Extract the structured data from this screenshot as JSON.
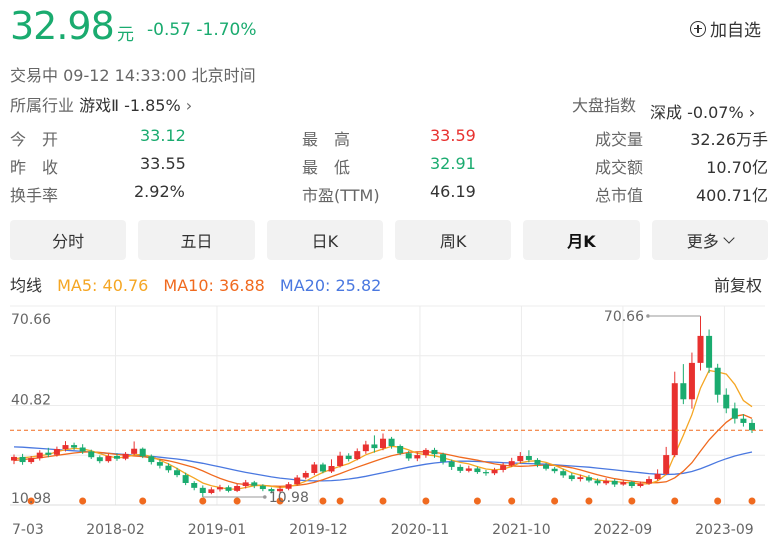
{
  "quote": {
    "price": "32.98",
    "unit": "元",
    "change": "-0.57 -1.70%",
    "add_label": "加自选",
    "status": "交易中  09-12 14:33:00  北京时间",
    "industry_label": "所属行业",
    "industry_value": "游戏Ⅱ -1.85%",
    "market_label": "大盘指数",
    "market_value": "深成 -0.07%",
    "colors": {
      "down": "#1aab6f",
      "up": "#e8312f",
      "neutral": "#333333"
    }
  },
  "stats": [
    {
      "label": "今　开",
      "value": "33.12",
      "color": "#1aab6f"
    },
    {
      "label": "最　高",
      "value": "33.59",
      "color": "#e8312f"
    },
    {
      "label": "成交量",
      "value": "32.26万手",
      "color": "#333333"
    },
    {
      "label": "昨　收",
      "value": "33.55",
      "color": "#333333"
    },
    {
      "label": "最　低",
      "value": "32.91",
      "color": "#1aab6f"
    },
    {
      "label": "成交额",
      "value": "10.70亿",
      "color": "#333333"
    },
    {
      "label": "换手率",
      "value": "2.92%",
      "color": "#333333"
    },
    {
      "label": "市盈(TTM)",
      "value": "46.19",
      "color": "#333333"
    },
    {
      "label": "总市值",
      "value": "400.71亿",
      "color": "#333333"
    }
  ],
  "tabs": [
    {
      "label": "分时",
      "active": false
    },
    {
      "label": "五日",
      "active": false
    },
    {
      "label": "日K",
      "active": false
    },
    {
      "label": "周K",
      "active": false
    },
    {
      "label": "月K",
      "active": true
    },
    {
      "label": "更多",
      "active": false
    }
  ],
  "ma": {
    "title": "均线",
    "ma5": "MA5: 40.76",
    "ma10": "MA10: 36.88",
    "ma20": "MA20: 25.82",
    "adjust": "前复权",
    "colors": {
      "ma5": "#f5a623",
      "ma10": "#f06a1f",
      "ma20": "#4a78e0"
    }
  },
  "chart_data": {
    "type": "candlestick",
    "y_ticks": [
      "70.66",
      "40.82",
      "10.98"
    ],
    "y_range": [
      10.98,
      70.66
    ],
    "x_ticks": [
      "7-03",
      "2018-02",
      "2019-01",
      "2019-12",
      "2020-11",
      "2021-10",
      "2022-09",
      "2023-09"
    ],
    "max_label": "70.66",
    "min_label": "10.98",
    "current_price": 32.98,
    "grid": true,
    "colors": {
      "up": "#e8312f",
      "down": "#1aab6f",
      "ma5": "#f5a623",
      "ma10": "#f06a1f",
      "ma20": "#4a78e0",
      "dots": "#f06a1f"
    },
    "candles": [
      [
        23,
        24.2,
        21.8,
        25
      ],
      [
        24.2,
        22.5,
        21.6,
        25.2
      ],
      [
        22.5,
        23.8,
        21.9,
        24.5
      ],
      [
        23.8,
        25.6,
        23,
        26.4
      ],
      [
        25.6,
        24.9,
        24.1,
        27.2
      ],
      [
        24.9,
        26.8,
        24.3,
        27.6
      ],
      [
        26.8,
        28.1,
        26,
        29.4
      ],
      [
        28.1,
        27.3,
        26.5,
        28.9
      ],
      [
        27.3,
        26,
        25.2,
        28.4
      ],
      [
        26,
        24.1,
        23.5,
        26.6
      ],
      [
        24.1,
        22.8,
        22.1,
        24.7
      ],
      [
        22.8,
        24.5,
        22.3,
        25.2
      ],
      [
        24.5,
        23.6,
        22.9,
        25.4
      ],
      [
        23.6,
        25.2,
        23.1,
        25.8
      ],
      [
        25.2,
        26.9,
        24.8,
        29.3
      ],
      [
        26.9,
        24.4,
        23.8,
        27.3
      ],
      [
        24.4,
        22.5,
        21.7,
        25
      ],
      [
        22.5,
        21.3,
        20.4,
        23.4
      ],
      [
        21.3,
        19.8,
        19,
        22.1
      ],
      [
        19.8,
        18.2,
        17.5,
        20.6
      ],
      [
        18.2,
        15.6,
        14.9,
        19
      ],
      [
        15.6,
        14,
        13.2,
        16.2
      ],
      [
        14,
        12.3,
        10.98,
        14.8
      ],
      [
        12.3,
        13.5,
        11.9,
        14.2
      ],
      [
        13.5,
        14.2,
        12.8,
        15
      ],
      [
        14.2,
        13,
        12.5,
        14.8
      ],
      [
        13,
        14.6,
        12.6,
        15.3
      ],
      [
        14.6,
        15.8,
        13.8,
        16.6
      ],
      [
        15.8,
        14.7,
        13.9,
        16.3
      ],
      [
        14.7,
        13.6,
        12.9,
        15.2
      ],
      [
        13.6,
        12.9,
        12.2,
        14.1
      ],
      [
        12.9,
        13.7,
        12.4,
        14.5
      ],
      [
        13.7,
        15.2,
        13.2,
        15.9
      ],
      [
        15.2,
        17.4,
        14.8,
        18.2
      ],
      [
        17.4,
        18.9,
        16.8,
        19.6
      ],
      [
        18.9,
        21.7,
        18.2,
        22.5
      ],
      [
        21.7,
        19.4,
        18.8,
        22.3
      ],
      [
        19.4,
        21.2,
        18.9,
        23.4
      ],
      [
        21.2,
        24.6,
        20.7,
        25.9
      ],
      [
        24.6,
        23.5,
        22.7,
        25.4
      ],
      [
        23.5,
        26.1,
        23.1,
        27
      ],
      [
        26.1,
        28.3,
        25.2,
        29.5
      ],
      [
        28.3,
        27.1,
        25.6,
        31.3
      ],
      [
        27.1,
        30.2,
        26.4,
        31.9
      ],
      [
        30.2,
        27.8,
        26.9,
        30.8
      ],
      [
        27.8,
        25.4,
        24.8,
        28.3
      ],
      [
        25.4,
        23.7,
        22.9,
        26.2
      ],
      [
        23.7,
        24.8,
        22.8,
        25.6
      ],
      [
        24.8,
        26.5,
        23.9,
        27.1
      ],
      [
        26.5,
        25.1,
        23.9,
        27.2
      ],
      [
        25.1,
        22.6,
        21.7,
        25.6
      ],
      [
        22.6,
        20.9,
        19.9,
        23.3
      ],
      [
        20.9,
        19.6,
        18.9,
        21.7
      ],
      [
        19.6,
        20.4,
        19.1,
        21.3
      ],
      [
        20.4,
        19.2,
        18.6,
        21
      ],
      [
        19.2,
        18.8,
        18,
        19.9
      ],
      [
        18.8,
        19.9,
        18.2,
        20.6
      ],
      [
        19.9,
        21.4,
        19.1,
        22.3
      ],
      [
        21.4,
        22.8,
        20.9,
        23.9
      ],
      [
        22.8,
        24.5,
        22.1,
        25.8
      ],
      [
        24.5,
        23.2,
        22.4,
        26.4
      ],
      [
        23.2,
        21.6,
        20.8,
        23.8
      ],
      [
        21.6,
        20.3,
        19.7,
        22.2
      ],
      [
        20.3,
        19.5,
        18.8,
        20.9
      ],
      [
        19.5,
        18.1,
        17.3,
        20.2
      ],
      [
        18.1,
        16.9,
        16.2,
        18.9
      ],
      [
        16.9,
        17.5,
        16.1,
        18.4
      ],
      [
        17.5,
        16.4,
        15.8,
        18.2
      ],
      [
        16.4,
        15.5,
        14.8,
        17.1
      ],
      [
        15.5,
        16.3,
        14.9,
        17.2
      ],
      [
        16.3,
        15.1,
        14.3,
        16.9
      ],
      [
        15.1,
        15.9,
        14.7,
        16.5
      ],
      [
        15.9,
        14.6,
        13.9,
        16.3
      ],
      [
        14.6,
        15.4,
        14.1,
        16.1
      ],
      [
        15.4,
        16.9,
        15,
        17.8
      ],
      [
        16.9,
        18.6,
        16.4,
        20.1
      ],
      [
        18.6,
        24.8,
        18.2,
        27.5
      ],
      [
        24.8,
        48.5,
        24.1,
        52.3
      ],
      [
        48.5,
        43.2,
        41.6,
        54.8
      ],
      [
        43.2,
        55.2,
        40.1,
        58.6
      ],
      [
        55.2,
        64.1,
        52.7,
        70.66
      ],
      [
        64.1,
        53.6,
        51.9,
        66.2
      ],
      [
        53.6,
        44.7,
        42.1,
        54.9
      ],
      [
        44.7,
        40.2,
        38.6,
        46.8
      ],
      [
        40.2,
        36.8,
        35.2,
        42.1
      ],
      [
        36.8,
        35.4,
        34.2,
        38.3
      ],
      [
        35.4,
        32.98,
        32.1,
        36.6
      ]
    ],
    "ma5": [
      23.6,
      23.9,
      24.2,
      24.6,
      25,
      25.9,
      26.6,
      27,
      26.8,
      26.2,
      25.3,
      24.4,
      23.9,
      24.1,
      24.9,
      25,
      24.3,
      23.1,
      21.9,
      20.4,
      18.7,
      17.2,
      15.6,
      14.7,
      14.1,
      13.6,
      13.6,
      14.1,
      14.7,
      14.8,
      14.5,
      14.1,
      14.3,
      15.1,
      16.2,
      17.7,
      19.1,
      20.1,
      21.1,
      22,
      23.4,
      24.9,
      25.9,
      26.8,
      27.7,
      27.4,
      26.5,
      25.4,
      24.9,
      24.6,
      23.9,
      23.1,
      22.4,
      21.9,
      21,
      20.2,
      19.9,
      20.2,
      21,
      22.3,
      22.8,
      22.9,
      22.4,
      21.4,
      20.2,
      19,
      18.2,
      17.3,
      16.6,
      16.3,
      16.1,
      15.8,
      15.6,
      15.3,
      15.3,
      16.3,
      18.4,
      25,
      31.3,
      38.1,
      46.9,
      52.7,
      52.2,
      51.5,
      48.1,
      42.8,
      40.76
    ],
    "ma10": [
      23,
      23.3,
      23.6,
      23.9,
      24.3,
      24.7,
      25.1,
      25.5,
      25.8,
      25.9,
      25.7,
      25.4,
      25,
      24.8,
      24.5,
      24.3,
      23.9,
      23.4,
      22.9,
      22.3,
      21.5,
      20.7,
      19.6,
      18.3,
      17.1,
      16.2,
      15.4,
      15.1,
      14.9,
      14.8,
      14.6,
      14.5,
      14.6,
      14.8,
      15.2,
      15.8,
      16.7,
      17.7,
      18.7,
      19.8,
      20.8,
      21.8,
      22.8,
      23.7,
      24.6,
      25.2,
      25.7,
      25.9,
      25.9,
      25.7,
      25.3,
      24.7,
      24.1,
      23.6,
      23.1,
      22.5,
      21.9,
      21.5,
      21.2,
      21.1,
      21.2,
      21.4,
      21.5,
      21.4,
      21.1,
      20.6,
      19.9,
      19.1,
      18.3,
      17.6,
      17,
      16.6,
      16.2,
      15.9,
      15.7,
      15.7,
      16,
      17.3,
      19.5,
      22.3,
      26.1,
      29.8,
      32.8,
      35.6,
      37.6,
      38.1,
      36.88
    ],
    "ma20": [
      27.5,
      27.4,
      27.2,
      27,
      26.8,
      26.6,
      26.4,
      26.2,
      26,
      25.8,
      25.6,
      25.4,
      25.2,
      25,
      24.8,
      24.6,
      24.4,
      24.1,
      23.8,
      23.5,
      23.1,
      22.6,
      22.1,
      21.5,
      20.9,
      20.3,
      19.7,
      19.1,
      18.6,
      18.1,
      17.6,
      17.2,
      16.9,
      16.6,
      16.4,
      16.3,
      16.3,
      16.4,
      16.6,
      16.9,
      17.3,
      17.8,
      18.4,
      19,
      19.6,
      20.2,
      20.8,
      21.3,
      21.8,
      22.2,
      22.5,
      22.7,
      22.8,
      22.8,
      22.7,
      22.6,
      22.5,
      22.3,
      22.2,
      22.1,
      22,
      21.9,
      21.8,
      21.6,
      21.4,
      21.2,
      21,
      20.8,
      20.5,
      20.2,
      19.9,
      19.6,
      19.3,
      19,
      18.7,
      18.5,
      18.4,
      18.5,
      18.8,
      19.4,
      20.3,
      21.4,
      22.6,
      23.6,
      24.5,
      25.2,
      25.82
    ],
    "dot_indices": [
      2,
      8,
      15,
      22,
      26,
      31,
      36,
      38,
      43,
      48,
      54,
      58,
      63,
      67,
      72,
      77,
      82,
      86
    ]
  }
}
